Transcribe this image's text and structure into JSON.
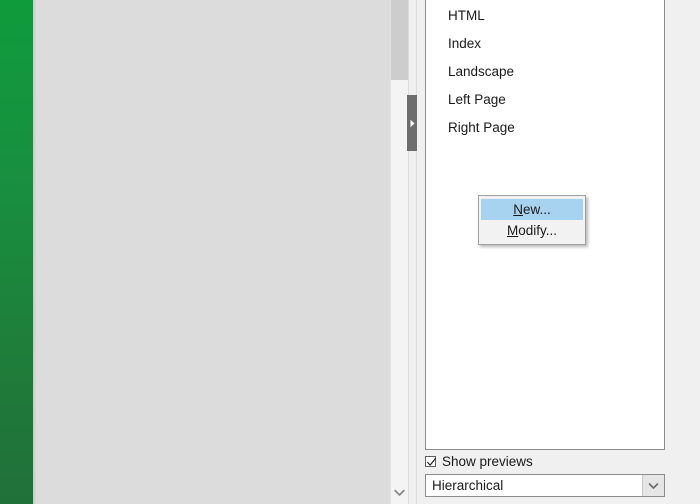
{
  "window": {
    "background_color": "#f0f0f0",
    "document_area_color": "#dcdcdc",
    "accent_green": "#189040",
    "selection_blue": "#a8d3f0"
  },
  "document_pane": {
    "scrollbar": {
      "thumb_label": "vertical-scroll-thumb",
      "down_arrow_label": "scroll-down"
    },
    "splitter": {
      "handle_label": "show-hide-sidebar"
    }
  },
  "sidebar": {
    "style_list": {
      "items": [
        {
          "label": "HTML"
        },
        {
          "label": "Index"
        },
        {
          "label": "Landscape"
        },
        {
          "label": "Left Page"
        },
        {
          "label": "Right Page"
        }
      ]
    },
    "context_menu": {
      "items": [
        {
          "label": "New...",
          "accel_prefix": "N",
          "accel_suffix": "ew...",
          "selected": true
        },
        {
          "label": "Modify...",
          "accel_prefix": "M",
          "accel_suffix": "odify...",
          "selected": false
        }
      ]
    },
    "show_previews": {
      "label": "Show previews",
      "checked": true
    },
    "filter": {
      "value": "Hierarchical",
      "options": [
        "Hierarchical"
      ]
    }
  }
}
